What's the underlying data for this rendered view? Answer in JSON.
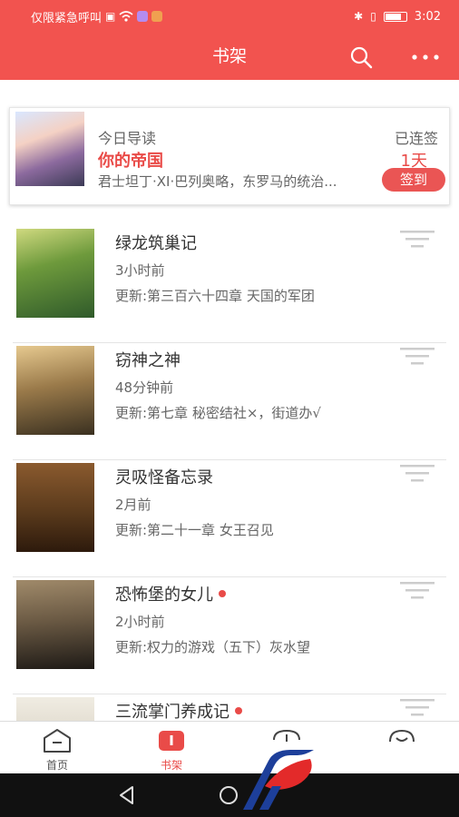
{
  "status_bar": {
    "carrier_text": "仅限紧急呼叫",
    "time": "3:02"
  },
  "nav": {
    "title": "书架"
  },
  "daily": {
    "label": "今日导读",
    "book_title": "你的帝国",
    "description": "君士坦丁·XI·巴列奥略，东罗马的统治...",
    "streak_label": "已连签",
    "streak_days": "1天",
    "signin_label": "签到"
  },
  "books": [
    {
      "title": "绿龙筑巢记",
      "time": "3小时前",
      "update": "更新:第三百六十四章 天国的军团",
      "new": false,
      "cover_colors": [
        "#9fb86a",
        "#2f5a2a"
      ]
    },
    {
      "title": "窃神之神",
      "time": "48分钟前",
      "update": "更新:第七章 秘密结社×，街道办√",
      "new": false,
      "cover_colors": [
        "#c8a46a",
        "#3a3020"
      ]
    },
    {
      "title": "灵吸怪备忘录",
      "time": "2月前",
      "update": "更新:第二十一章 女王召见",
      "new": false,
      "cover_colors": [
        "#8a5a2e",
        "#2d1a0c"
      ]
    },
    {
      "title": "恐怖堡的女儿",
      "time": "2小时前",
      "update": "更新:权力的游戏（五下）灰水望",
      "new": true,
      "cover_colors": [
        "#6b5a44",
        "#1e1a16"
      ]
    },
    {
      "title": "三流掌门养成记",
      "time": "",
      "update": "",
      "new": true,
      "cover_colors": [
        "#e8e4d8",
        "#9a9080"
      ]
    }
  ],
  "tabs": [
    {
      "label": "首页",
      "icon": "home-icon"
    },
    {
      "label": "书架",
      "icon": "bookshelf-icon"
    },
    {
      "label": "",
      "icon": "discover-icon"
    },
    {
      "label": "",
      "icon": "profile-icon"
    }
  ],
  "colors": {
    "brand_red": "#f2534f",
    "accent_red": "#e94b48"
  }
}
